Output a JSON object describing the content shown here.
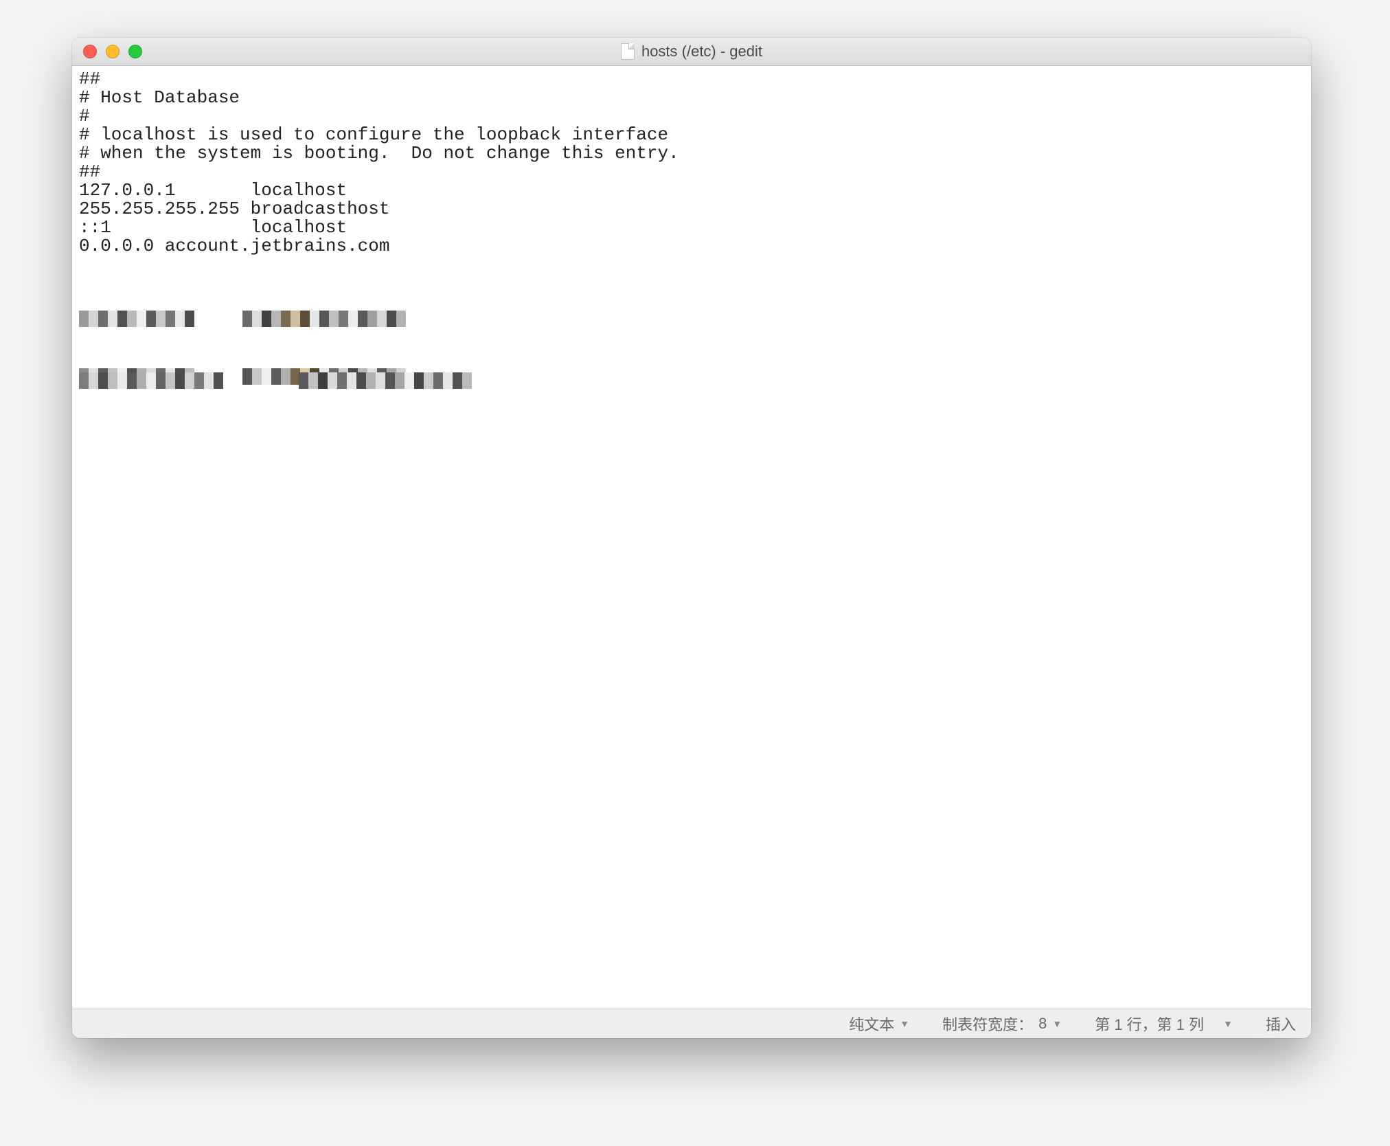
{
  "window": {
    "title": "hosts (/etc) - gedit"
  },
  "editor": {
    "content": "##\n# Host Database\n#\n# localhost is used to configure the loopback interface\n# when the system is booting.  Do not change this entry.\n##\n127.0.0.1       localhost\n255.255.255.255 broadcasthost\n::1             localhost\n0.0.0.0 account.jetbrains.com"
  },
  "statusbar": {
    "language": "纯文本",
    "tab_width_label": "制表符宽度：",
    "tab_width_value": "8",
    "position": "第 1 行，第 1 列",
    "insert_mode": "插入"
  }
}
